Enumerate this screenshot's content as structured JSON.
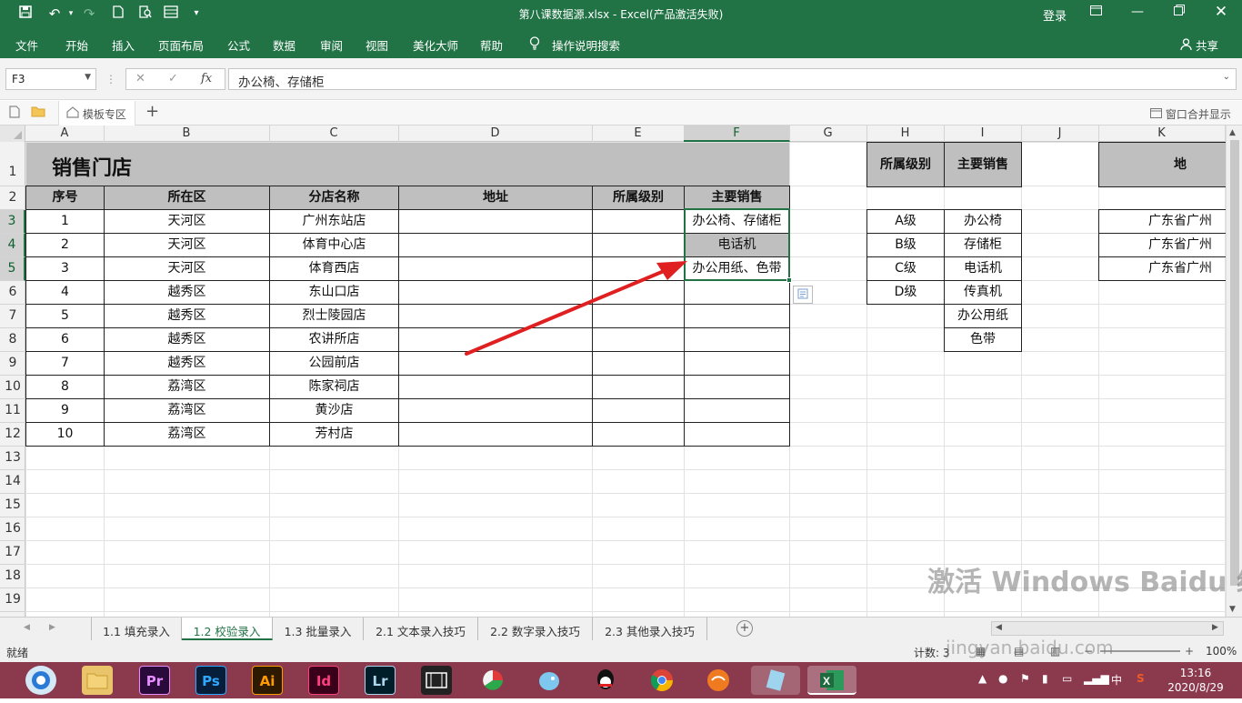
{
  "window": {
    "title": "第八课数据源.xlsx  -  Excel(产品激活失败)",
    "login_label": "登录"
  },
  "quick_access": {
    "save_icon": "save-icon",
    "undo_icon": "undo-icon",
    "redo_icon": "redo-icon"
  },
  "ribbon_tabs": [
    "文件",
    "开始",
    "插入",
    "页面布局",
    "公式",
    "数据",
    "审阅",
    "视图",
    "美化大师",
    "帮助",
    "操作说明搜索"
  ],
  "share_label": "共享",
  "formula_bar": {
    "name_box": "F3",
    "fx": "fx",
    "content": "办公椅、存储柜"
  },
  "toolbar": {
    "template_label": "模板专区",
    "merge_label": "窗口合并显示"
  },
  "columns": [
    "A",
    "B",
    "C",
    "D",
    "E",
    "F",
    "G",
    "H",
    "I",
    "J",
    "K"
  ],
  "rows": [
    "1",
    "2",
    "3",
    "4",
    "5",
    "6",
    "7",
    "8",
    "9",
    "10",
    "11",
    "12",
    "13",
    "14",
    "15",
    "16",
    "17",
    "18",
    "19"
  ],
  "table": {
    "title": "销售门店",
    "headers": [
      "序号",
      "所在区",
      "分店名称",
      "地址",
      "所属级别",
      "主要销售"
    ],
    "rows": [
      [
        "1",
        "天河区",
        "广州东站店",
        "",
        "",
        "办公椅、存储柜"
      ],
      [
        "2",
        "天河区",
        "体育中心店",
        "",
        "",
        "电话机"
      ],
      [
        "3",
        "天河区",
        "体育西店",
        "",
        "",
        "办公用纸、色带"
      ],
      [
        "4",
        "越秀区",
        "东山口店",
        "",
        "",
        ""
      ],
      [
        "5",
        "越秀区",
        "烈士陵园店",
        "",
        "",
        ""
      ],
      [
        "6",
        "越秀区",
        "农讲所店",
        "",
        "",
        ""
      ],
      [
        "7",
        "越秀区",
        "公园前店",
        "",
        "",
        ""
      ],
      [
        "8",
        "荔湾区",
        "陈家祠店",
        "",
        "",
        ""
      ],
      [
        "9",
        "荔湾区",
        "黄沙店",
        "",
        "",
        ""
      ],
      [
        "10",
        "荔湾区",
        "芳村店",
        "",
        "",
        ""
      ]
    ]
  },
  "level_list": {
    "header": "所属级别",
    "items": [
      "A级",
      "B级",
      "C级",
      "D级"
    ]
  },
  "sales_list": {
    "header": "主要销售",
    "items": [
      "办公椅",
      "存储柜",
      "电话机",
      "传真机",
      "办公用纸",
      "色带"
    ]
  },
  "address_list": {
    "header": "地",
    "items": [
      "广东省广州",
      "广东省广州",
      "广东省广州"
    ]
  },
  "sheet_tabs": [
    "1.1 填充录入",
    "1.2 校验录入",
    "1.3 批量录入",
    "2.1 文本录入技巧",
    "2.2 数字录入技巧",
    "2.3 其他录入技巧"
  ],
  "active_sheet": "1.2 校验录入",
  "status": {
    "ready": "就绪",
    "count": "计数: 3",
    "zoom": "100%"
  },
  "taskbar": {
    "apps": [
      "Pr",
      "Ps",
      "Ai",
      "Id",
      "Lr"
    ],
    "time": "13:16",
    "date": "2020/8/29",
    "ime": "中"
  },
  "watermark": {
    "line1": "激活 Windows",
    "brand": "Baidu 经验",
    "url": "jingyan.baidu.com"
  },
  "colors": {
    "excel_green": "#217346",
    "header_gray": "#bfbfbf",
    "taskbar": "#8b3a4e",
    "arrow_red": "#e02020"
  }
}
